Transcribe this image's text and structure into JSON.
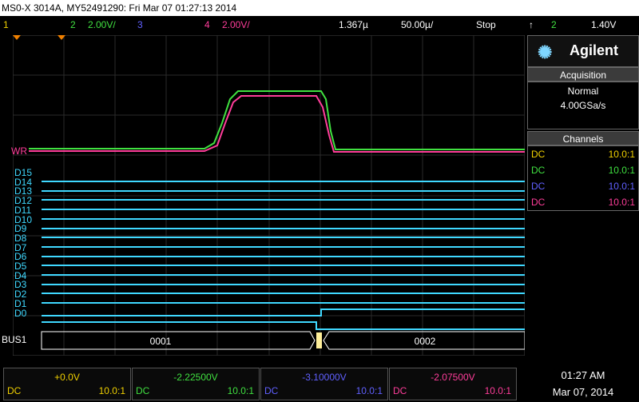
{
  "title": "MS0-X 3014A, MY52491290: Fri Mar 07 01:27:13 2014",
  "status": {
    "ch1_num": "1",
    "ch2_num": "2",
    "ch2_scale": "2.00V/",
    "ch3_num": "3",
    "ch4_num": "4",
    "ch4_scale": "2.00V/",
    "delay": "1.367µ",
    "timebase": "50.00µ/",
    "run_state": "Stop",
    "trigger_symbol": "↑",
    "trigger_ch": "2",
    "trigger_level": "1.40V"
  },
  "sidebar": {
    "brand": "Agilent",
    "acq_header": "Acquisition",
    "acq_mode": "Normal",
    "acq_rate": "4.00GSa/s",
    "ch_header": "Channels",
    "channels": [
      {
        "coupling": "DC",
        "probe": "10.0:1",
        "color": "#f0d000"
      },
      {
        "coupling": "DC",
        "probe": "10.0:1",
        "color": "#40e040"
      },
      {
        "coupling": "DC",
        "probe": "10.0:1",
        "color": "#6060ff"
      },
      {
        "coupling": "DC",
        "probe": "10.0:1",
        "color": "#ff3d9a"
      }
    ]
  },
  "plot": {
    "trig_marker": "T",
    "wr_label": "WR",
    "digital_labels": [
      "D15",
      "D14",
      "D13",
      "D12",
      "D11",
      "D10",
      "D9",
      "D8",
      "D7",
      "D6",
      "D5",
      "D4",
      "D3",
      "D2",
      "D1",
      "D0"
    ],
    "bus_label": "BUS1",
    "bus_values": [
      "0001",
      "0002"
    ]
  },
  "bottom": {
    "boxes": [
      {
        "offset": "+0.0V",
        "coupling": "DC",
        "probe": "10.0:1",
        "color": "#f0d000"
      },
      {
        "offset": "-2.22500V",
        "coupling": "DC",
        "probe": "10.0:1",
        "color": "#40e040"
      },
      {
        "offset": "-3.10000V",
        "coupling": "DC",
        "probe": "10.0:1",
        "color": "#6060ff"
      },
      {
        "offset": "-2.07500V",
        "coupling": "DC",
        "probe": "10.0:1",
        "color": "#ff3d9a"
      }
    ],
    "time": "01:27 AM",
    "date": "Mar 07, 2014"
  }
}
